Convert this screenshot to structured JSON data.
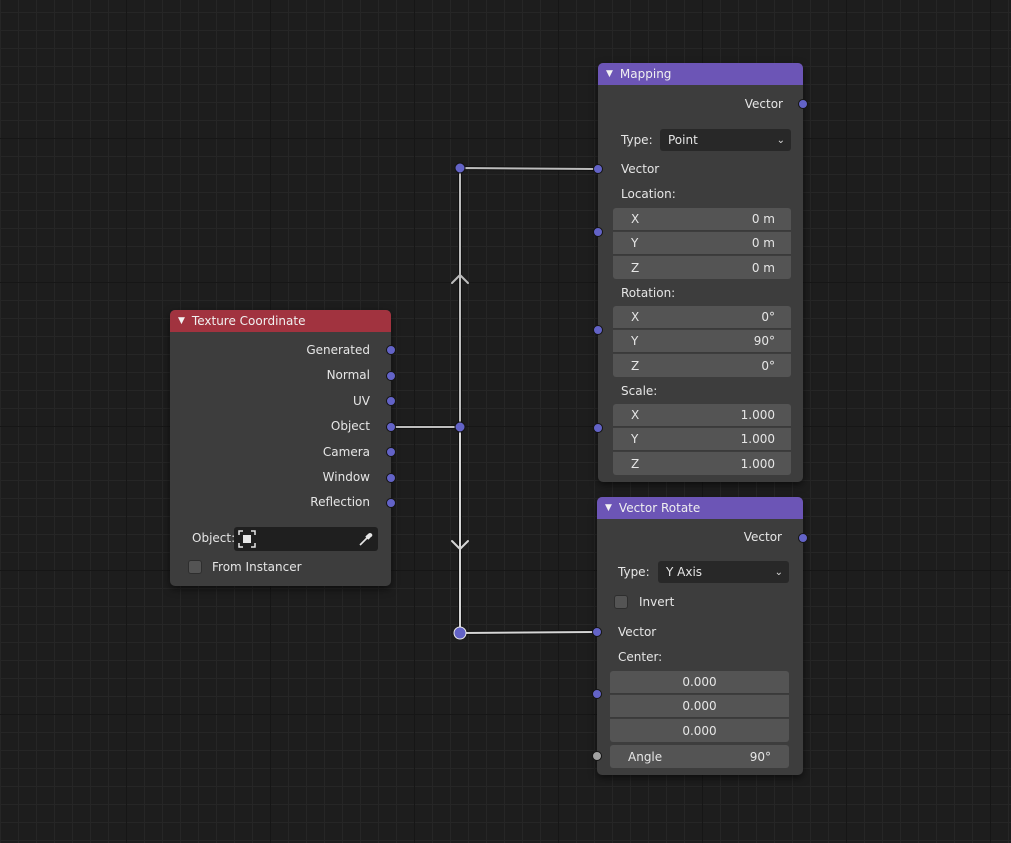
{
  "colors": {
    "canvas_bg": "#1d1d1d",
    "node_bg": "#3d3d3d",
    "header_input": "#a1333f",
    "header_vector": "#6c55b6",
    "socket_vector": "#6363c7",
    "socket_float": "#a1a1a1",
    "link": "#bdbdbd"
  },
  "texture_coordinate": {
    "title": "Texture Coordinate",
    "outputs": [
      "Generated",
      "Normal",
      "UV",
      "Object",
      "Camera",
      "Window",
      "Reflection"
    ],
    "object_label": "Object:",
    "from_instancer_label": "From Instancer",
    "from_instancer_checked": false
  },
  "mapping": {
    "title": "Mapping",
    "output_label": "Vector",
    "type_label": "Type:",
    "type_value": "Point",
    "vector_label": "Vector",
    "location_label": "Location:",
    "location": [
      {
        "axis": "X",
        "value": "0 m"
      },
      {
        "axis": "Y",
        "value": "0 m"
      },
      {
        "axis": "Z",
        "value": "0 m"
      }
    ],
    "rotation_label": "Rotation:",
    "rotation": [
      {
        "axis": "X",
        "value": "0°"
      },
      {
        "axis": "Y",
        "value": "90°"
      },
      {
        "axis": "Z",
        "value": "0°"
      }
    ],
    "scale_label": "Scale:",
    "scale": [
      {
        "axis": "X",
        "value": "1.000"
      },
      {
        "axis": "Y",
        "value": "1.000"
      },
      {
        "axis": "Z",
        "value": "1.000"
      }
    ]
  },
  "vector_rotate": {
    "title": "Vector Rotate",
    "output_label": "Vector",
    "type_label": "Type:",
    "type_value": "Y Axis",
    "invert_label": "Invert",
    "invert_checked": false,
    "vector_label": "Vector",
    "center_label": "Center:",
    "center": [
      "0.000",
      "0.000",
      "0.000"
    ],
    "angle_label": "Angle",
    "angle_value": "90°"
  }
}
